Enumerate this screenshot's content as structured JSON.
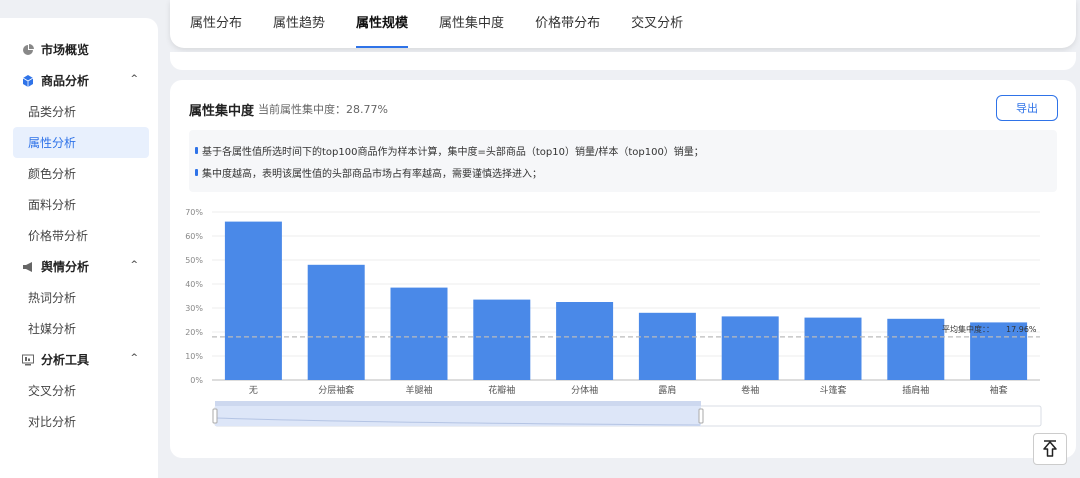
{
  "sidebar": {
    "groups": [
      {
        "label": "市场概览",
        "icon": "pie-chart-icon",
        "items": []
      },
      {
        "label": "商品分析",
        "icon": "cube-icon",
        "items": [
          "品类分析",
          "属性分析",
          "颜色分析",
          "面料分析",
          "价格带分析"
        ]
      },
      {
        "label": "舆情分析",
        "icon": "megaphone-icon",
        "items": [
          "热词分析",
          "社媒分析"
        ]
      },
      {
        "label": "分析工具",
        "icon": "monitor-icon",
        "items": [
          "交叉分析",
          "对比分析"
        ]
      }
    ],
    "active_item": "属性分析",
    "accent": "#2f73e8"
  },
  "tabs": {
    "items": [
      "属性分布",
      "属性趋势",
      "属性规模",
      "属性集中度",
      "价格带分布",
      "交叉分析"
    ],
    "active": "属性规模"
  },
  "card": {
    "title": "属性集中度",
    "subtitle": "当前属性集中度：28.77%",
    "export_label": "导出",
    "info_lines": [
      "基于各属性值所选时间下的top100商品作为样本计算，集中度=头部商品（top10）销量/样本（top100）销量；",
      "集中度越高，表明该属性值的头部商品市场占有率越高，需要谨慎选择进入；"
    ]
  },
  "chart_data": {
    "type": "bar",
    "categories": [
      "无",
      "分层袖套",
      "羊腿袖",
      "花瓣袖",
      "分体袖",
      "露肩",
      "卷袖",
      "斗篷套",
      "插肩袖",
      "袖套"
    ],
    "values": [
      66,
      48,
      38.5,
      33.5,
      32.5,
      28,
      26.5,
      26,
      25.5,
      24
    ],
    "ylim": [
      0,
      70
    ],
    "yticks": [
      "0%",
      "10%",
      "20%",
      "30%",
      "40%",
      "50%",
      "60%",
      "70%"
    ],
    "grid": true,
    "bar_color": "#4a89e8",
    "average_line": {
      "label": "平均集中度：：",
      "value_label": "17.96%",
      "value": 17.96
    }
  }
}
